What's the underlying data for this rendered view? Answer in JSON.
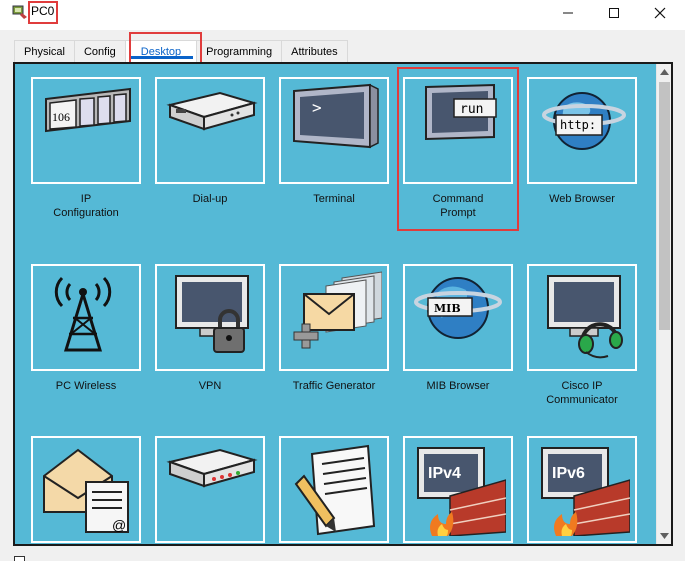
{
  "window": {
    "title": "PC0"
  },
  "tabs": [
    {
      "label": "Physical"
    },
    {
      "label": "Config"
    },
    {
      "label": "Desktop"
    },
    {
      "label": "Programming"
    },
    {
      "label": "Attributes"
    }
  ],
  "active_tab": "Desktop",
  "apps": [
    {
      "label": "IP\nConfiguration",
      "icon": "ip-configuration-icon",
      "icon_text": "106"
    },
    {
      "label": "Dial-up",
      "icon": "dial-up-modem-icon"
    },
    {
      "label": "Terminal",
      "icon": "terminal-icon",
      "icon_text": ">"
    },
    {
      "label": "Command\nPrompt",
      "icon": "command-prompt-icon",
      "icon_text": "run"
    },
    {
      "label": "Web Browser",
      "icon": "web-browser-icon",
      "icon_text": "http:"
    },
    {
      "label": "PC Wireless",
      "icon": "wireless-tower-icon"
    },
    {
      "label": "VPN",
      "icon": "vpn-lock-icon"
    },
    {
      "label": "Traffic Generator",
      "icon": "traffic-generator-icon"
    },
    {
      "label": "MIB Browser",
      "icon": "mib-browser-icon",
      "icon_text": "MIB"
    },
    {
      "label": "Cisco IP Communicator",
      "icon": "ip-communicator-headset-icon"
    },
    {
      "label": "",
      "icon": "email-icon",
      "icon_text": "@"
    },
    {
      "label": "",
      "icon": "pppoe-dialer-icon"
    },
    {
      "label": "",
      "icon": "text-editor-icon"
    },
    {
      "label": "",
      "icon": "ipv4-firewall-icon",
      "icon_text": "IPv4"
    },
    {
      "label": "",
      "icon": "ipv6-firewall-icon",
      "icon_text": "IPv6"
    }
  ],
  "colors": {
    "panel_bg": "#55b9d6",
    "active_tab": "#0a63c9",
    "highlight": "#e03c3c"
  }
}
